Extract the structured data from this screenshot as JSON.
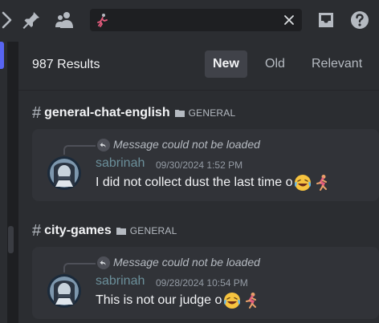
{
  "search": {
    "query": "🏃‍♀️"
  },
  "results": {
    "count_label": "987 Results",
    "sort_tabs": [
      {
        "label": "New",
        "active": true
      },
      {
        "label": "Old",
        "active": false
      },
      {
        "label": "Relevant",
        "active": false
      }
    ]
  },
  "groups": [
    {
      "channel": "general-chat-english",
      "category": "GENERAL",
      "message": {
        "reply_text": "Message could not be loaded",
        "username": "sabrinah",
        "timestamp": "09/30/2024 1:52 PM",
        "content": "I did not collect dust the last time o",
        "emojis": [
          "joy-emoji",
          "woman-running-emoji"
        ]
      }
    },
    {
      "channel": "city-games",
      "category": "GENERAL",
      "message": {
        "reply_text": "Message could not be loaded",
        "username": "sabrinah",
        "timestamp": "09/28/2024 10:54 PM",
        "content": "This is not our judge o",
        "emojis": [
          "joy-emoji",
          "woman-running-emoji"
        ]
      }
    }
  ],
  "colors": {
    "accent": "#5865f2",
    "username": "#6b8f9a",
    "panel_bg": "#2b2d31",
    "card_bg": "#313338"
  }
}
